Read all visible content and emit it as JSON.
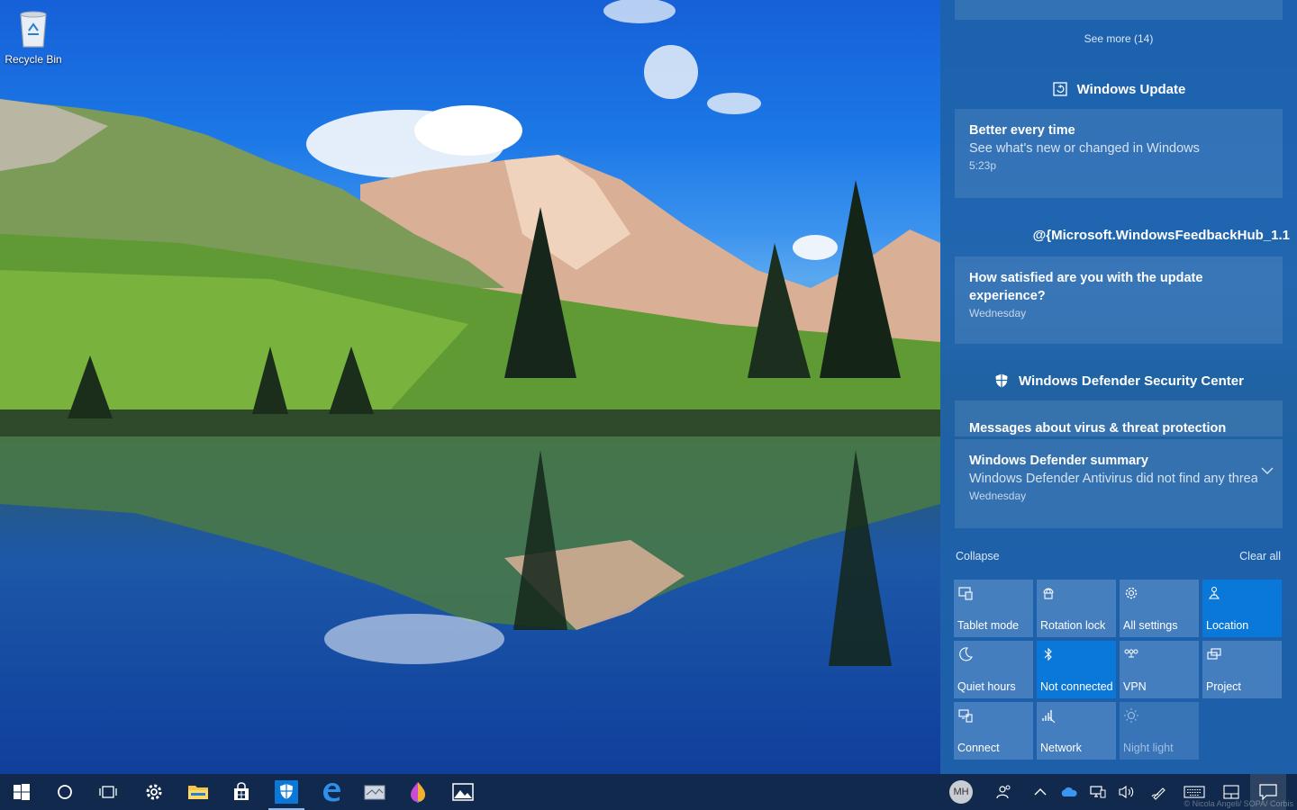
{
  "desktop": {
    "recycle_bin_label": "Recycle Bin"
  },
  "action_center": {
    "see_more": "See more (14)",
    "groups": [
      {
        "header": "Windows Update",
        "icon": "windows-update-icon",
        "notifications": [
          {
            "title": "Better every time",
            "body": "See what's new or changed in Windows",
            "time": "5:23p"
          }
        ]
      },
      {
        "header": "@{Microsoft.WindowsFeedbackHub_1.1",
        "icon": "",
        "notifications": [
          {
            "title": "How satisfied are you with the update experience?",
            "body": "",
            "time": "Wednesday"
          }
        ]
      },
      {
        "header": "Windows Defender Security Center",
        "icon": "shield-icon",
        "notifications": [
          {
            "title": "Messages about virus & threat protection",
            "body": "",
            "time": ""
          },
          {
            "title": "Windows Defender summary",
            "body": "Windows Defender Antivirus did not find any threats",
            "time": "Wednesday"
          }
        ]
      }
    ],
    "collapse_label": "Collapse",
    "clear_all_label": "Clear all",
    "quick_actions": [
      {
        "label": "Tablet mode",
        "icon": "tablet-mode-icon",
        "state": "off"
      },
      {
        "label": "Rotation lock",
        "icon": "rotation-lock-icon",
        "state": "off"
      },
      {
        "label": "All settings",
        "icon": "gear-icon",
        "state": "off"
      },
      {
        "label": "Location",
        "icon": "location-icon",
        "state": "on"
      },
      {
        "label": "Quiet hours",
        "icon": "moon-icon",
        "state": "off"
      },
      {
        "label": "Not connected",
        "icon": "bluetooth-icon",
        "state": "on"
      },
      {
        "label": "VPN",
        "icon": "vpn-icon",
        "state": "off"
      },
      {
        "label": "Project",
        "icon": "project-icon",
        "state": "off"
      },
      {
        "label": "Connect",
        "icon": "connect-icon",
        "state": "off"
      },
      {
        "label": "Network",
        "icon": "network-icon",
        "state": "off"
      },
      {
        "label": "Night light",
        "icon": "night-light-icon",
        "state": "disabled"
      }
    ]
  },
  "taskbar": {
    "user_initials": "MH",
    "watermark": "© Nicola Angeli/ SOPA/ Corbis",
    "colors": {
      "accent": "#0a78d8",
      "taskbar": "#10294d"
    }
  }
}
